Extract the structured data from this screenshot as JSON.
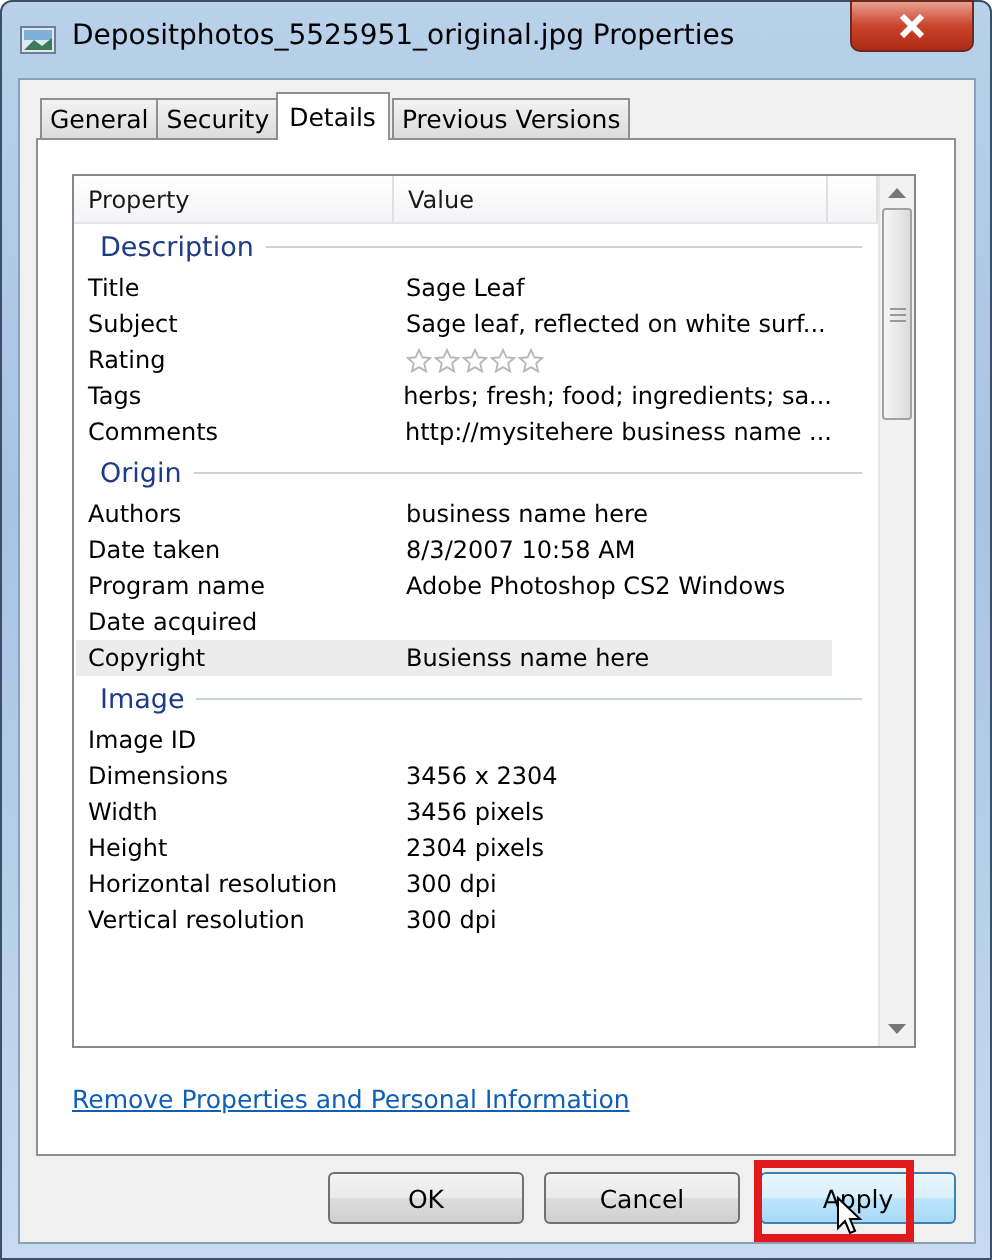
{
  "window": {
    "title": "Depositphotos_5525951_original.jpg Properties"
  },
  "tabs": [
    {
      "label": "General",
      "selected": false
    },
    {
      "label": "Security",
      "selected": false
    },
    {
      "label": "Details",
      "selected": true
    },
    {
      "label": "Previous Versions",
      "selected": false
    }
  ],
  "table": {
    "columns": [
      "Property",
      "Value"
    ],
    "groups": [
      {
        "label": "Description",
        "rows": [
          {
            "kind": "text",
            "property": "Title",
            "value": "Sage Leaf",
            "selected": false
          },
          {
            "kind": "text",
            "property": "Subject",
            "value": "Sage leaf, reflected on white surf...",
            "selected": false
          },
          {
            "kind": "stars",
            "property": "Rating",
            "stars": 0,
            "selected": false
          },
          {
            "kind": "text",
            "property": "Tags",
            "value": "herbs; fresh; food; ingredients; sa...",
            "selected": false
          },
          {
            "kind": "text",
            "property": "Comments",
            "value": "http://mysitehere business name ...",
            "selected": false
          }
        ]
      },
      {
        "label": "Origin",
        "rows": [
          {
            "kind": "text",
            "property": "Authors",
            "value": "business name here",
            "selected": false
          },
          {
            "kind": "text",
            "property": "Date taken",
            "value": "8/3/2007 10:58 AM",
            "selected": false
          },
          {
            "kind": "text",
            "property": "Program name",
            "value": "Adobe Photoshop CS2 Windows",
            "selected": false
          },
          {
            "kind": "text",
            "property": "Date acquired",
            "selected": false
          },
          {
            "kind": "text",
            "property": "Copyright",
            "value": "Busienss name here",
            "selected": true
          }
        ]
      },
      {
        "label": "Image",
        "rows": [
          {
            "kind": "text",
            "property": "Image ID",
            "selected": false
          },
          {
            "kind": "text",
            "property": "Dimensions",
            "value": "3456 x 2304",
            "selected": false
          },
          {
            "kind": "text",
            "property": "Width",
            "value": "3456 pixels",
            "selected": false
          },
          {
            "kind": "text",
            "property": "Height",
            "value": "2304 pixels",
            "selected": false
          },
          {
            "kind": "text",
            "property": "Horizontal resolution",
            "value": "300 dpi",
            "selected": false
          },
          {
            "kind": "text",
            "property": "Vertical resolution",
            "value": "300 dpi",
            "selected": false
          }
        ]
      }
    ]
  },
  "link": "Remove Properties and Personal Information",
  "buttons": [
    {
      "label": "OK",
      "hovered": false,
      "highlighted": false
    },
    {
      "label": "Cancel",
      "hovered": false,
      "highlighted": false
    },
    {
      "label": "Apply",
      "hovered": true,
      "highlighted": true
    }
  ]
}
